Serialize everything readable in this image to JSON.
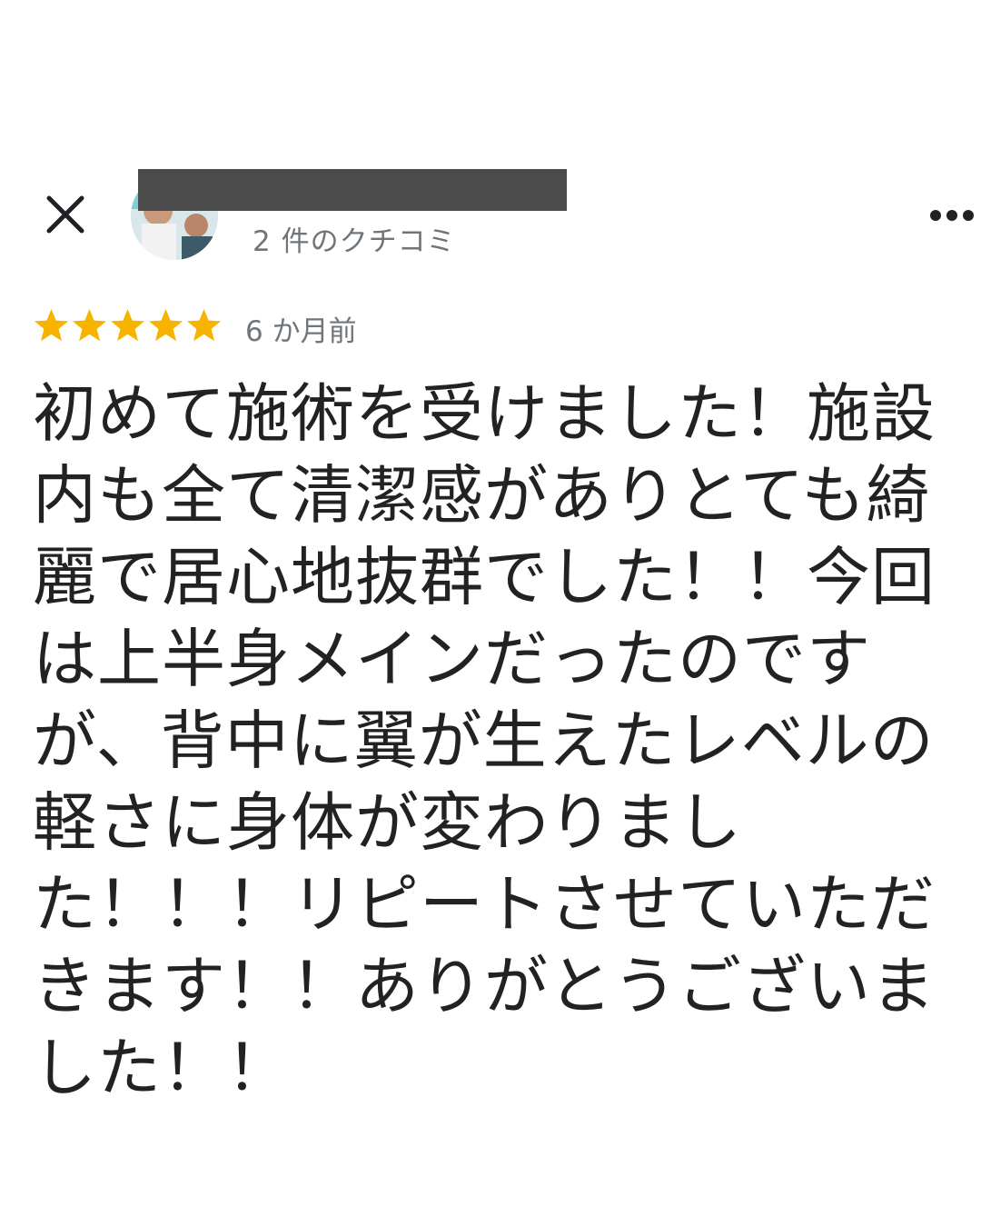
{
  "header": {
    "close_icon": "close-icon",
    "reviewer_avatar": "avatar-photo",
    "review_count": "2 件のクチコミ",
    "more_icon": "more-horizontal-icon"
  },
  "review": {
    "rating": 5,
    "rating_max": 5,
    "star_color": "#f6b400",
    "timestamp": "6 か月前",
    "lines": [
      "初めて施術を受けました！施設",
      "内も全て清潔感がありとても綺",
      "麗で居心地抜群でした！！今回",
      "は上半身メインだったのです",
      "が、背中に翼が生えたレベルの",
      "軽さに身体が変わりまし",
      "た！！！リピートさせていただ",
      "きます！！ありがとうございま",
      "した！！"
    ]
  }
}
